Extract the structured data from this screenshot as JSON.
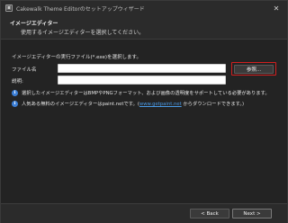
{
  "window": {
    "title": "Cakewalk Theme Editorのセットアップウィザード",
    "app_icon": "installer-icon"
  },
  "header": {
    "title": "イメージエディター",
    "subtitle": "使用するイメージエディターを選択してください。"
  },
  "main": {
    "instruction": "イメージエディターの実行ファイル(*.exe)を選択します。",
    "filename": {
      "label": "ファイル名",
      "value": "",
      "placeholder": ""
    },
    "description": {
      "label": "説明:",
      "value": "",
      "placeholder": ""
    },
    "browse_label": "参照...",
    "info1": "選択したイメージエディターはBMPやPNGフォーマット、および画像の透明度をサポートしている必要があります。",
    "info2_prefix": "人気ある無料のイメージエディターはpaint.netです。(",
    "info2_link": "www.getpaint.net",
    "info2_suffix": " からダウンロードできます。)"
  },
  "footer": {
    "back_label": "< Back",
    "next_label": "Next >"
  },
  "colors": {
    "accent": "#3c7fd6",
    "highlight_border": "#d21f1f",
    "link": "#4a9be8"
  }
}
